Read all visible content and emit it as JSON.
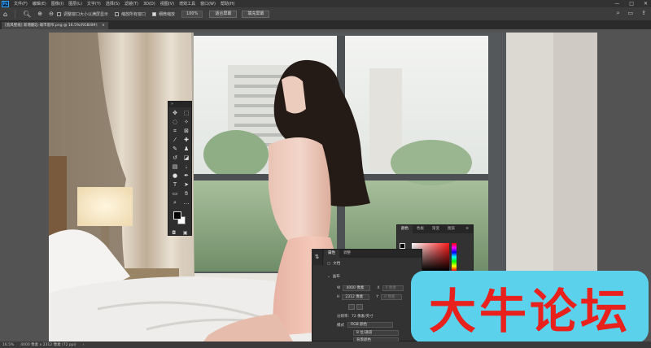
{
  "app": {
    "logo": "Ps"
  },
  "menu": [
    "文件(F)",
    "编辑(E)",
    "图像(I)",
    "图层(L)",
    "文字(Y)",
    "选择(S)",
    "滤镜(T)",
    "3D(D)",
    "视图(V)",
    "增效工具",
    "窗口(W)",
    "帮助(H)"
  ],
  "window_controls": {
    "minimize": "—",
    "maximize": "□",
    "close": "✕"
  },
  "options": {
    "resize_windows": "调整窗口大小以满屏显示",
    "zoom_all_windows": "缩放所有窗口",
    "scrubby_zoom": "细微缩放",
    "zoom_value": "100%",
    "fit_screen": "适合屏幕",
    "fill_screen": "填充屏幕"
  },
  "tab": {
    "label": "[宽风壁纸] 新增翻忘-城市窗帘.png @ 16.5%(RGB/8#)",
    "close": "×"
  },
  "status": {
    "zoom": "16.5%",
    "size": "4000 像素 x 2312 像素 (72 ppi)",
    "arrow": "›"
  },
  "color_panel": {
    "tabs": [
      "颜色",
      "色板",
      "渐变",
      "图案"
    ],
    "menu": "≡"
  },
  "properties": {
    "tabs": [
      "属性",
      "调整"
    ],
    "doc_label": "文档",
    "canvas_label": "画布",
    "w_label": "W",
    "w_value": "4000 像素",
    "x_label": "X",
    "x_value": "0 像素",
    "h_label": "H",
    "h_value": "2312 像素",
    "y_label": "Y",
    "y_value": "0 像素",
    "resolution": "分辨率：72 像素/英寸",
    "mode_label": "模式",
    "mode_value": "RGB 颜色",
    "depth_value": "8 位/通道",
    "bg_value": "背景颜色"
  },
  "watermark": "大牛论坛",
  "colors": {
    "foreground": "#000000",
    "background": "#ffffff",
    "watermark_bg": "#5bd1ec",
    "watermark_text": "#e8211d"
  }
}
